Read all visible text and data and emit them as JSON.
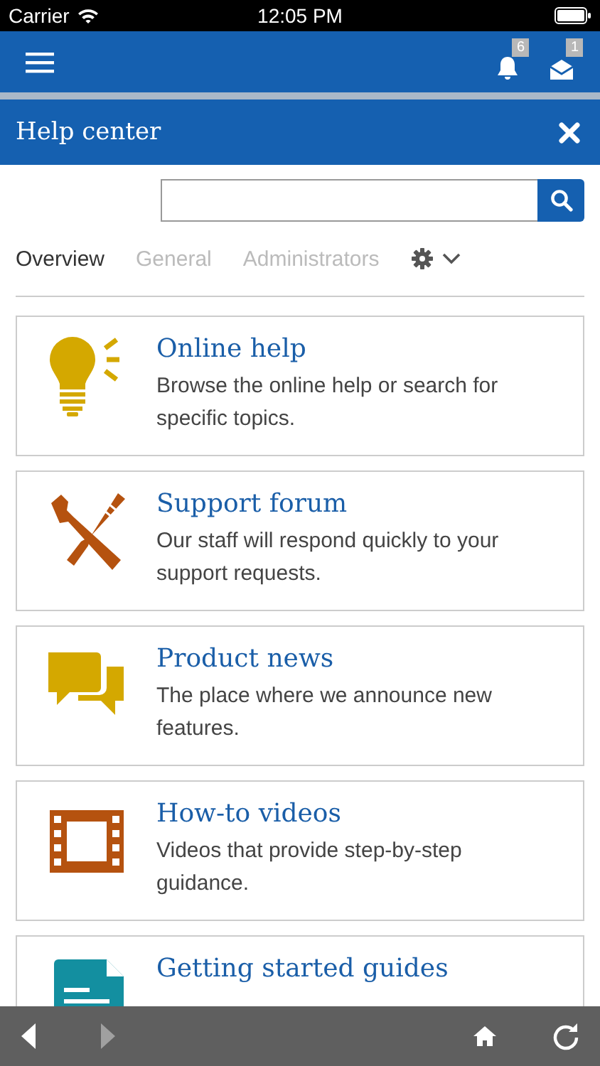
{
  "status_bar": {
    "carrier": "Carrier",
    "time": "12:05 PM"
  },
  "nav_bar": {
    "notifications": "6",
    "messages": "1"
  },
  "panel": {
    "title": "Help center"
  },
  "tabs": [
    {
      "label": "Overview",
      "selected": true
    },
    {
      "label": "General",
      "selected": false
    },
    {
      "label": "Administrators",
      "selected": false
    }
  ],
  "cards": [
    {
      "kind": "bulb",
      "title": "Online help",
      "description": "Browse the online help or search for specific topics."
    },
    {
      "kind": "tools",
      "title": "Support forum",
      "description": "Our staff will respond quickly to your support requests."
    },
    {
      "kind": "chat",
      "title": "Product news",
      "description": "The place where we announce new features."
    },
    {
      "kind": "film",
      "title": "How-to videos",
      "description": "Videos that provide step-by-step guidance."
    },
    {
      "kind": "document",
      "title": "Getting started guides"
    }
  ],
  "toolbar": {
    "back_disabled": false,
    "forward_disabled": true
  }
}
